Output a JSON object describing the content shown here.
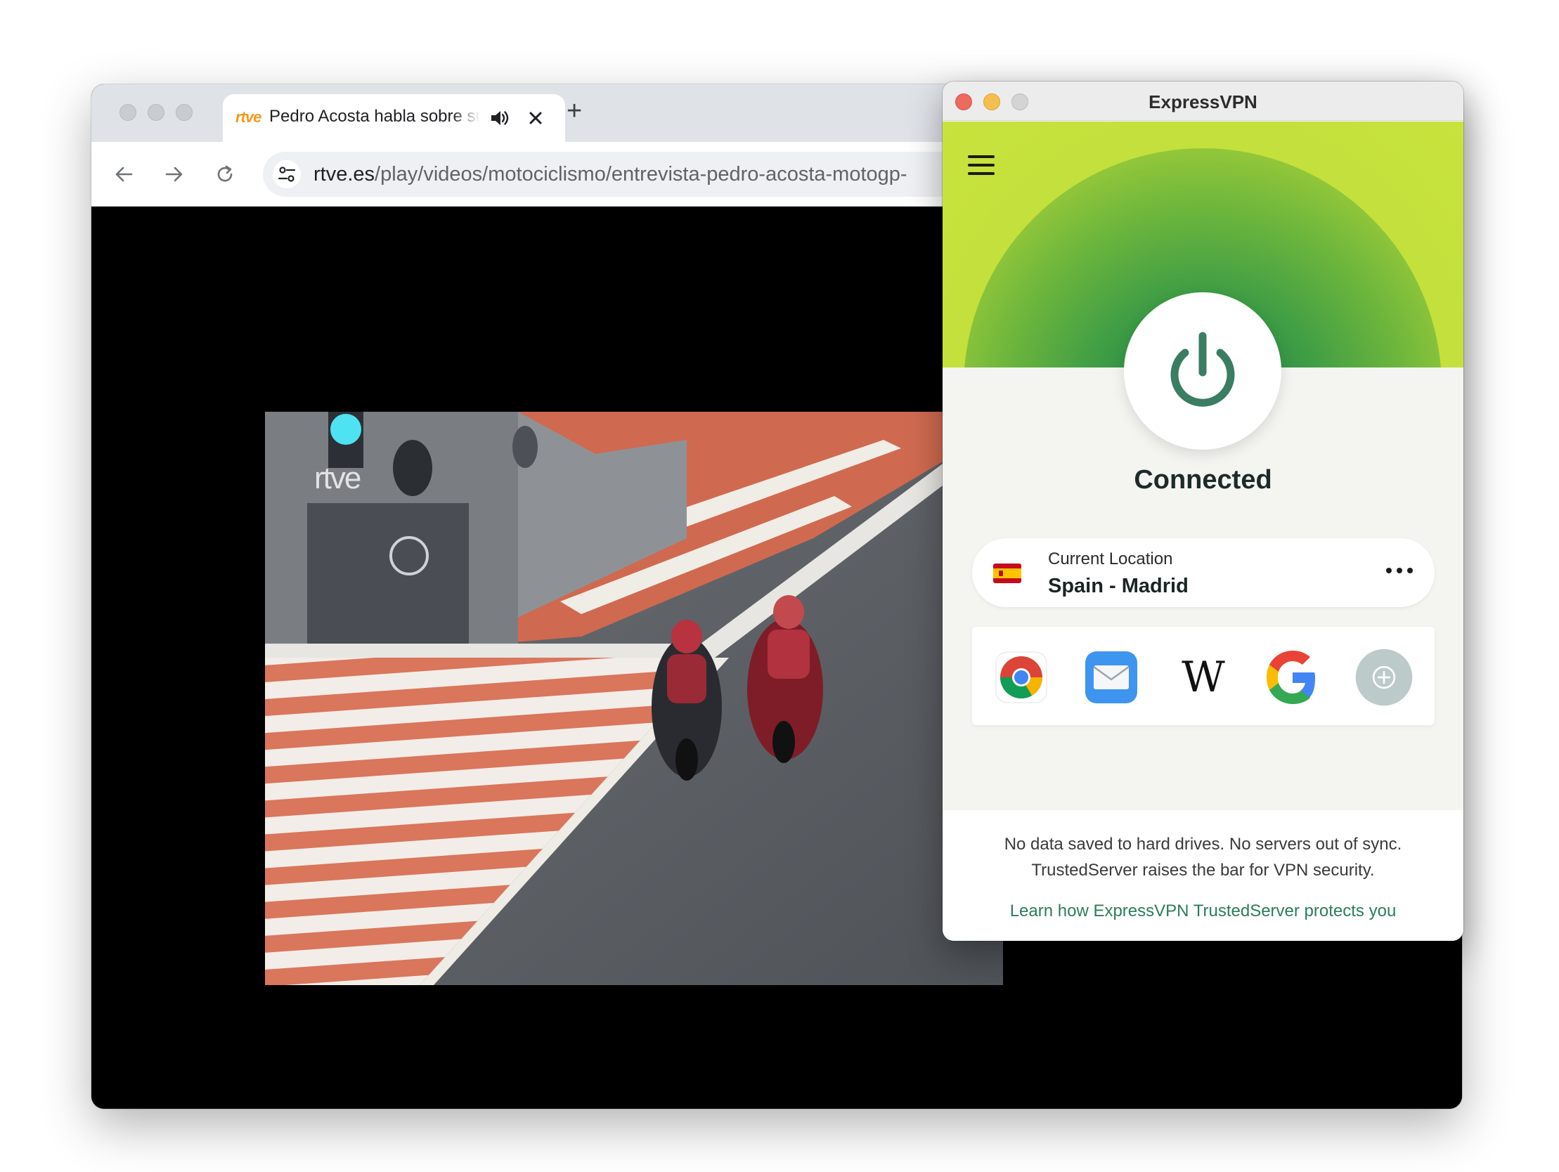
{
  "browser": {
    "tab": {
      "favicon_text": "rtve",
      "title": "Pedro Acosta habla sobre su fichaje por KTM",
      "audio_icon": "speaker-icon",
      "close_icon": "close-icon"
    },
    "new_tab_label": "+",
    "toolbar": {
      "back_icon": "arrow-left-icon",
      "forward_icon": "arrow-right-icon",
      "reload_icon": "reload-icon",
      "site_settings_icon": "tune-icon"
    },
    "url": {
      "host": "rtve.es",
      "path": "/play/videos/motociclismo/entrevista-pedro-acosta-motogp-"
    },
    "video": {
      "watermark": "rtve"
    }
  },
  "vpn": {
    "window_title": "ExpressVPN",
    "menu_icon": "hamburger-menu-icon",
    "power_icon": "power-icon",
    "status": "Connected",
    "location": {
      "label": "Current Location",
      "value": "Spain - Madrid",
      "flag": "spain-flag-icon",
      "more_icon": "more-options-icon"
    },
    "shortcuts": [
      {
        "name": "chrome-icon"
      },
      {
        "name": "mail-icon"
      },
      {
        "name": "wikipedia-icon",
        "glyph": "W"
      },
      {
        "name": "google-icon"
      },
      {
        "name": "add-shortcut-icon"
      }
    ],
    "footer": {
      "line1": "No data saved to hard drives. No servers out of sync.",
      "line2": "TrustedServer raises the bar for VPN security.",
      "link": "Learn how ExpressVPN TrustedServer protects you"
    },
    "colors": {
      "close": "#ed6a5e",
      "minimize": "#f5bf4f",
      "zoom": "#cfcfcf",
      "power_green": "#3a7d63",
      "link_green": "#2b7d5a"
    }
  }
}
